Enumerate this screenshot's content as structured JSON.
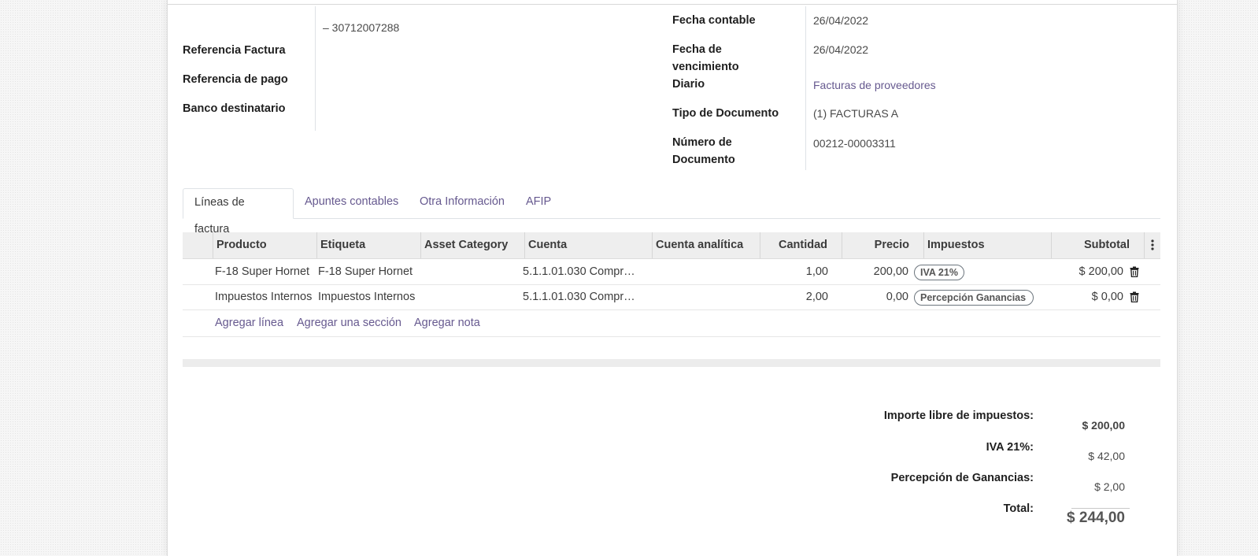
{
  "header": {
    "partner_vat": "– 30712007288",
    "left_labels": [
      "Referencia Factura",
      "Referencia de pago",
      "Banco destinatario"
    ],
    "right_fields": [
      {
        "label": "Fecha contable",
        "value": "26/04/2022"
      },
      {
        "label": "Fecha de vencimiento",
        "value": "26/04/2022"
      },
      {
        "label": "Diario",
        "value": "Facturas de proveedores"
      },
      {
        "label": "Tipo de Documento",
        "value": "(1) FACTURAS A"
      },
      {
        "label": "Número de Documento",
        "value": "00212-00003311"
      }
    ]
  },
  "tabs": [
    {
      "label": "Líneas de factura",
      "active": true
    },
    {
      "label": "Apuntes contables",
      "active": false
    },
    {
      "label": "Otra Información",
      "active": false
    },
    {
      "label": "AFIP",
      "active": false
    }
  ],
  "table": {
    "columns": [
      "Producto",
      "Etiqueta",
      "Asset Category",
      "Cuenta",
      "Cuenta analítica",
      "Cantidad",
      "Precio",
      "Impuestos",
      "Subtotal"
    ],
    "rows": [
      {
        "producto": "F-18 Super Hornet",
        "etiqueta": "F-18 Super Hornet",
        "asset_category": "",
        "cuenta": "5.1.1.01.030 Compras de mercaderías",
        "cuenta_analitica": "",
        "cantidad": "1,00",
        "precio": "200,00",
        "impuestos": "IVA 21%",
        "subtotal": "$ 200,00"
      },
      {
        "producto": "Impuestos Internos",
        "etiqueta": "Impuestos Internos",
        "asset_category": "",
        "cuenta": "5.1.1.01.030 Compras de mercaderías",
        "cuenta_analitica": "",
        "cantidad": "2,00",
        "precio": "0,00",
        "impuestos": "Percepción Ganancias",
        "subtotal": "$ 0,00"
      }
    ],
    "actions": [
      "Agregar línea",
      "Agregar una sección",
      "Agregar nota"
    ],
    "optional_columns_icon": "vertical-dots-icon",
    "row_delete_icon": "trash-icon"
  },
  "totals": [
    {
      "label": "Importe libre de impuestos:",
      "value": "$ 200,00"
    },
    {
      "label": "IVA 21%:",
      "value": "$ 42,00"
    },
    {
      "label": "Percepción de Ganancias:",
      "value": "$ 2,00"
    },
    {
      "label": "Total:",
      "value": "$ 244,00"
    }
  ],
  "colors": {
    "link": "#66598f",
    "header_bg": "#eeeeee"
  }
}
